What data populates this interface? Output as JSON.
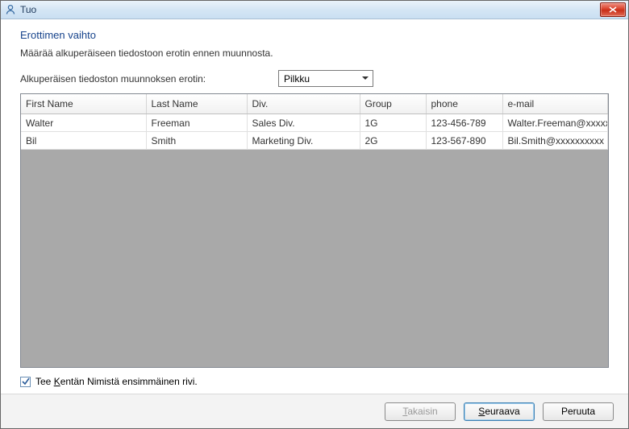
{
  "window": {
    "title": "Tuo"
  },
  "section": {
    "heading": "Erottimen vaihto",
    "description": "Määrää alkuperäiseen tiedostoon erotin ennen muunnosta.",
    "separator_label": "Alkuperäisen tiedoston muunnoksen erotin:"
  },
  "dropdown": {
    "selected": "Pilkku"
  },
  "table": {
    "columns": [
      "First Name",
      "Last Name",
      "Div.",
      "Group",
      "phone",
      "e-mail"
    ],
    "rows": [
      [
        "Walter",
        "Freeman",
        "Sales Div.",
        "1G",
        "123-456-789",
        "Walter.Freeman@xxxxxxxx"
      ],
      [
        "Bil",
        "Smith",
        "Marketing Div.",
        "2G",
        "123-567-890",
        "Bil.Smith@xxxxxxxxxx"
      ]
    ]
  },
  "checkbox": {
    "checked": true,
    "label_pre": "Tee ",
    "label_key": "K",
    "label_post": "entän Nimistä ensimmäinen rivi."
  },
  "buttons": {
    "back_key": "T",
    "back_post": "akaisin",
    "next_key": "S",
    "next_post": "euraava",
    "cancel": "Peruuta"
  }
}
